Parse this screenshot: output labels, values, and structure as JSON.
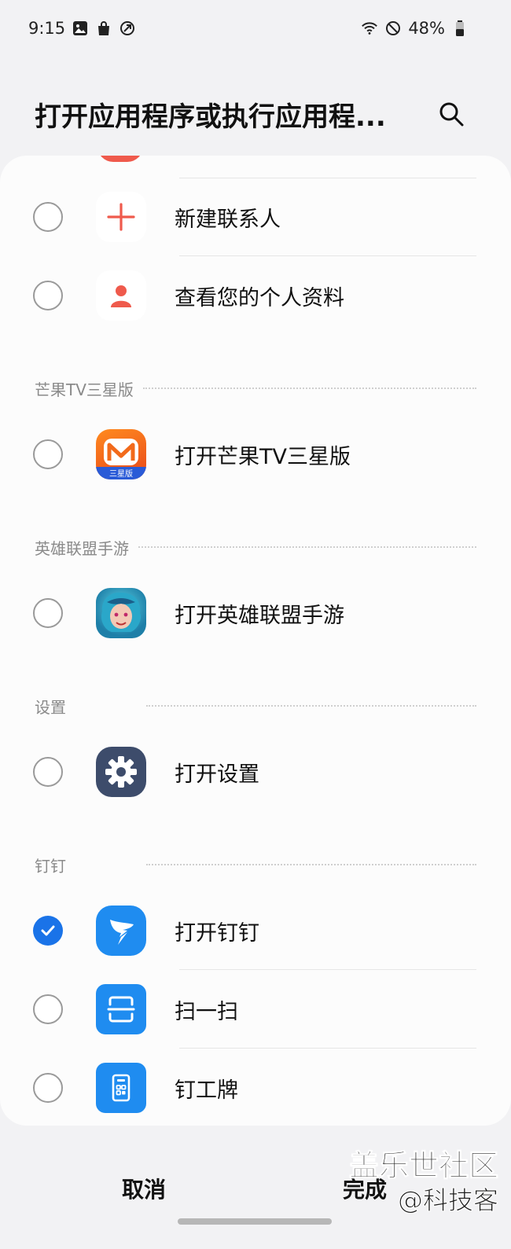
{
  "status_bar": {
    "time": "9:15",
    "left_icons": [
      "gallery-icon",
      "shopping-bag-icon",
      "cast-icon"
    ],
    "right_icons": [
      "wifi-icon",
      "do-not-disturb-icon"
    ],
    "battery": "48%"
  },
  "header": {
    "title": "打开应用程序或执行应用程..."
  },
  "contacts_items": [
    {
      "label": "新建联系人",
      "icon": "add-contact-icon",
      "checked": false
    },
    {
      "label": "查看您的个人资料",
      "icon": "profile-icon",
      "checked": false
    }
  ],
  "sections": {
    "mango": {
      "title": "芒果TV三星版",
      "item": {
        "label": "打开芒果TV三星版",
        "icon_badge": "三星版",
        "checked": false
      }
    },
    "lol": {
      "title": "英雄联盟手游",
      "item": {
        "label": "打开英雄联盟手游",
        "checked": false
      }
    },
    "settings": {
      "title": "设置",
      "item": {
        "label": "打开设置",
        "checked": false
      }
    },
    "dingtalk": {
      "title": "钉钉",
      "items": [
        {
          "label": "打开钉钉",
          "checked": true
        },
        {
          "label": "扫一扫",
          "checked": false
        },
        {
          "label": "钉工牌",
          "checked": false
        }
      ]
    }
  },
  "bottom_bar": {
    "cancel_label": "取消",
    "done_label": "完成"
  },
  "watermark": {
    "line1": "盖乐世社区",
    "line2": "@科技客"
  },
  "colors": {
    "accent": "#1a73e8",
    "contact_red": "#ef5a4c",
    "settings_navy": "#3d4c6b",
    "dingtalk_blue": "#1f8cf0",
    "mango_orange": "#f26a1b"
  }
}
